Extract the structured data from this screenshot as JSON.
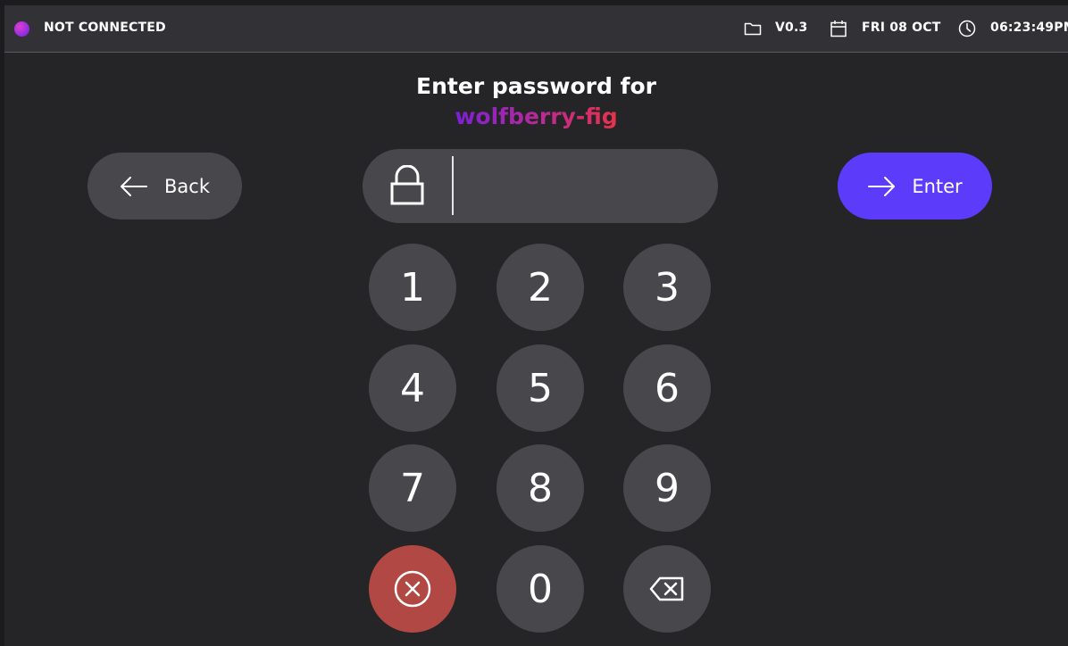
{
  "status_bar": {
    "connection": "NOT CONNECTED",
    "version": "V0.3",
    "date": "FRI 08 OCT",
    "time": "06:23:49PM",
    "icons": [
      "status-dot",
      "folder-icon",
      "calendar-icon",
      "clock-icon"
    ]
  },
  "prompt": {
    "title": "Enter password for",
    "username": "wolfberry-fig"
  },
  "buttons": {
    "back_label": "Back",
    "enter_label": "Enter"
  },
  "password_field": {
    "value": "",
    "icon": "lock-icon"
  },
  "keypad": {
    "keys": [
      "1",
      "2",
      "3",
      "4",
      "5",
      "6",
      "7",
      "8",
      "9",
      "0"
    ],
    "clear_icon": "clear-circle-x-icon",
    "backspace_icon": "backspace-icon"
  },
  "colors": {
    "background": "#252528",
    "status_bar": "#323236",
    "key": "#48484c",
    "accent": "#5c3cfa",
    "clear": "#b24843",
    "username_gradient": [
      "#7b1fd8",
      "#e8324a"
    ]
  }
}
